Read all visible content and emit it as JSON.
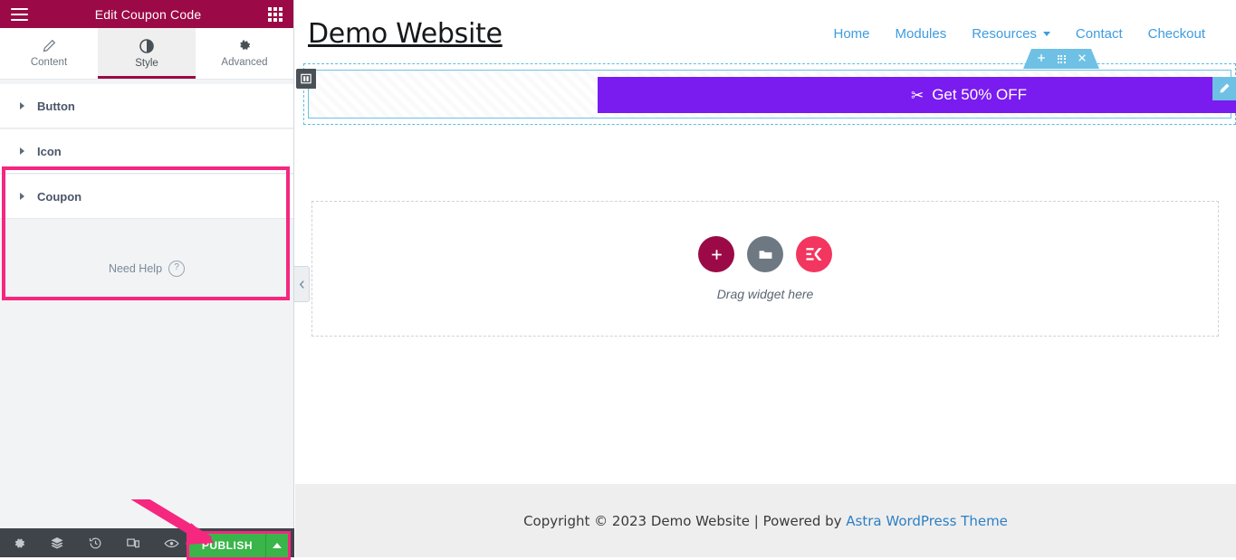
{
  "panel": {
    "header": {
      "title": "Edit Coupon Code",
      "menu_icon": "hamburger-icon",
      "apps_icon": "widgets-grid-icon"
    },
    "tabs": [
      {
        "label": "Content",
        "icon": "pencil-icon",
        "active": false
      },
      {
        "label": "Style",
        "icon": "contrast-half-circle-icon",
        "active": true
      },
      {
        "label": "Advanced",
        "icon": "gear-icon",
        "active": false
      }
    ],
    "sections": [
      {
        "label": "Button",
        "expanded": false
      },
      {
        "label": "Icon",
        "expanded": false
      },
      {
        "label": "Coupon",
        "expanded": false
      }
    ],
    "need_help": {
      "label": "Need Help",
      "icon": "question-mark-icon"
    },
    "collapse_icon": "chevron-left-icon",
    "footer": {
      "icons": [
        {
          "name": "settings-gear-icon"
        },
        {
          "name": "navigator-layers-icon"
        },
        {
          "name": "history-clock-icon"
        },
        {
          "name": "responsive-mode-icon"
        },
        {
          "name": "preview-eye-icon"
        }
      ],
      "publish_label": "PUBLISH",
      "publish_caret_icon": "caret-up-icon"
    },
    "highlight_color": "#f5277f",
    "header_color": "#9b0a46",
    "publish_color": "#39b54a"
  },
  "canvas": {
    "site_title": "Demo Website",
    "nav": [
      {
        "label": "Home",
        "has_dropdown": false
      },
      {
        "label": "Modules",
        "has_dropdown": false
      },
      {
        "label": "Resources",
        "has_dropdown": true
      },
      {
        "label": "Contact",
        "has_dropdown": false
      },
      {
        "label": "Checkout",
        "has_dropdown": false
      }
    ],
    "nav_color": "#3d9ce0",
    "element_toolbar": {
      "add_icon": "plus-icon",
      "drag_icon": "drag-dots-icon",
      "close_icon": "close-x-icon"
    },
    "column_handle_icon": "column-layout-icon",
    "edit_pencil_icon": "edit-pencil-icon",
    "coupon": {
      "icon": "scissors-icon",
      "text": "Get 50% OFF",
      "background": "#7a1bf0"
    },
    "dropzone": {
      "add_widget_icon": "plus-circle-icon",
      "folder_icon": "folder-template-icon",
      "elementskit_icon": "elementskit-logo-icon",
      "label": "Drag widget here"
    },
    "footer": {
      "prefix": "Copyright © 2023 Demo Website | Powered by ",
      "link": "Astra WordPress Theme"
    }
  }
}
